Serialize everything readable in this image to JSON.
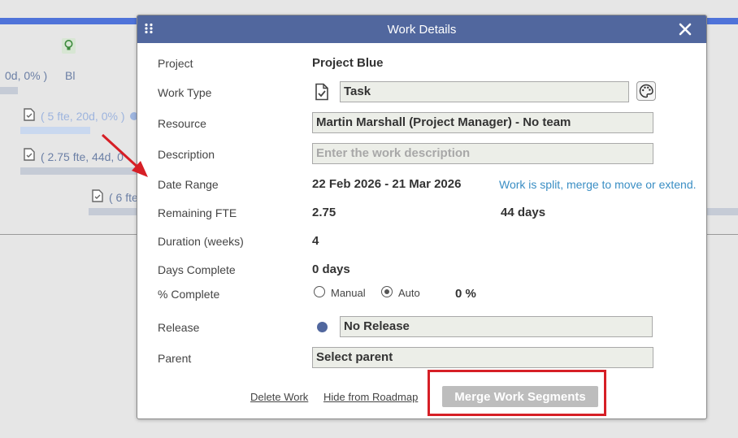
{
  "background": {
    "row1_text": "0d, 0% )",
    "row1_suffix": "Bl",
    "row2_text": "( 5 fte, 20d, 0% )",
    "row3_text": "( 2.75 fte, 44d, 0",
    "row4_text": "( 6 fte"
  },
  "dialog": {
    "title": "Work Details",
    "fields": {
      "project_label": "Project",
      "project_value": "Project Blue",
      "work_type_label": "Work Type",
      "work_type_value": "Task",
      "resource_label": "Resource",
      "resource_value": "Martin Marshall (Project Manager) - No team",
      "description_label": "Description",
      "description_placeholder": "Enter the work description",
      "date_range_label": "Date Range",
      "date_range_value": "22 Feb 2026 - 21 Mar 2026",
      "split_notice": "Work is split, merge to move or extend.",
      "remaining_fte_label": "Remaining FTE",
      "remaining_fte_value": "2.75",
      "days_value": "44 days",
      "duration_label": "Duration (weeks)",
      "duration_value": "4",
      "days_complete_label": "Days Complete",
      "days_complete_value": "0 days",
      "pct_complete_label": "% Complete",
      "pct_option_manual": "Manual",
      "pct_option_auto": "Auto",
      "pct_selected": "Auto",
      "pct_value": "0 %",
      "release_label": "Release",
      "release_value": "No Release",
      "parent_label": "Parent",
      "parent_value": "Select parent"
    },
    "footer": {
      "delete_label": "Delete Work",
      "hide_label": "Hide from Roadmap",
      "merge_label": "Merge Work Segments"
    }
  },
  "colors": {
    "header": "#51679e",
    "link": "#3a8ec4",
    "annotation": "#d61f26",
    "merge_button": "#bdbdbd",
    "field_bg": "#eceee8"
  },
  "icons": {
    "drag": "grip-dots-icon",
    "close": "close-icon",
    "work_type": "document-check-icon",
    "palette": "palette-icon",
    "release": "circle-dot-icon"
  }
}
